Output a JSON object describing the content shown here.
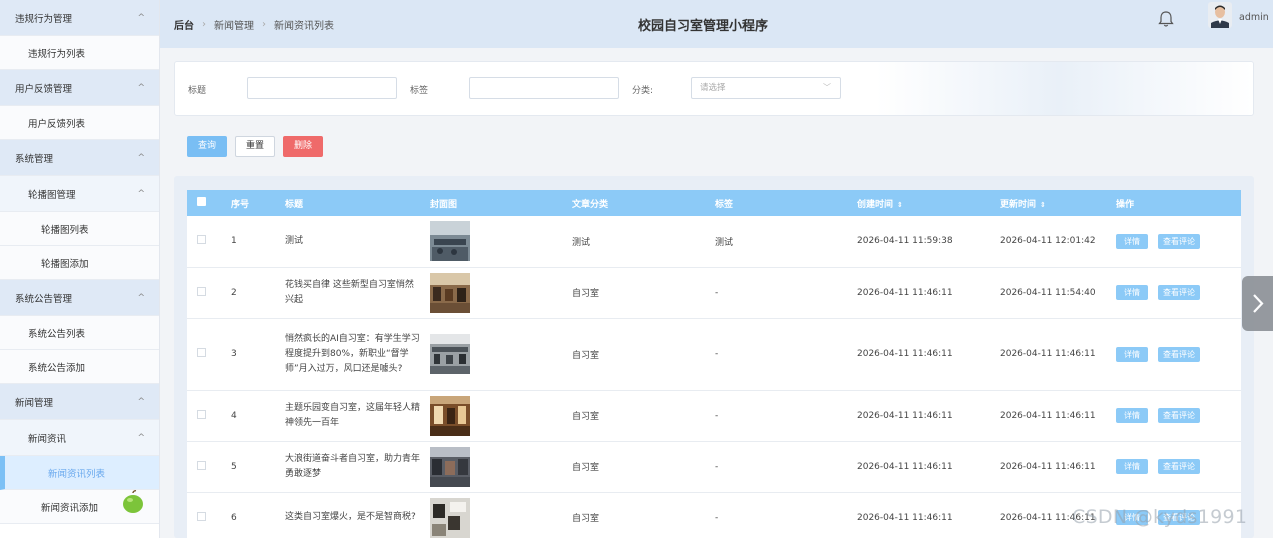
{
  "header": {
    "breadcrumb": [
      "后台",
      "新闻管理",
      "新闻资讯列表"
    ],
    "app_title": "校园自习室管理小程序",
    "user_name": "admin"
  },
  "sidebar": {
    "items": [
      {
        "label": "违规行为管理",
        "kind": "group",
        "caret": "^"
      },
      {
        "label": "违规行为列表",
        "kind": "item"
      },
      {
        "label": "用户反馈管理",
        "kind": "group",
        "caret": "^"
      },
      {
        "label": "用户反馈列表",
        "kind": "item"
      },
      {
        "label": "系统管理",
        "kind": "group",
        "caret": "^"
      },
      {
        "label": "轮播图管理",
        "kind": "sub",
        "caret": "^"
      },
      {
        "label": "轮播图列表",
        "kind": "item3"
      },
      {
        "label": "轮播图添加",
        "kind": "item3"
      },
      {
        "label": "系统公告管理",
        "kind": "group",
        "caret": "^"
      },
      {
        "label": "系统公告列表",
        "kind": "item"
      },
      {
        "label": "系统公告添加",
        "kind": "item"
      },
      {
        "label": "新闻管理",
        "kind": "group",
        "caret": "^"
      },
      {
        "label": "新闻资讯",
        "kind": "sub",
        "caret": "^"
      },
      {
        "label": "新闻资讯列表",
        "kind": "item3",
        "active": true
      },
      {
        "label": "新闻资讯添加",
        "kind": "item3"
      }
    ]
  },
  "search": {
    "title_label": "标题",
    "tag_label": "标签",
    "category_label": "分类:",
    "category_placeholder": "请选择",
    "title_value": "",
    "tag_value": ""
  },
  "actions": {
    "query": "查询",
    "reset": "重置",
    "delete": "删除"
  },
  "table": {
    "columns": [
      "序号",
      "标题",
      "封面图",
      "文章分类",
      "标签",
      "创建时间",
      "更新时间",
      "操作"
    ],
    "sort_icon": "⇕",
    "op_detail": "详情",
    "op_comments": "查看评论",
    "rows": [
      {
        "no": "1",
        "title": "测试",
        "category": "测试",
        "tag": "测试",
        "created": "2026-04-11 11:59:38",
        "updated": "2026-04-11 12:01:42"
      },
      {
        "no": "2",
        "title": "花钱买自律 这些新型自习室悄然兴起",
        "category": "自习室",
        "tag": "-",
        "created": "2026-04-11 11:46:11",
        "updated": "2026-04-11 11:54:40"
      },
      {
        "no": "3",
        "title": "悄然疯长的AI自习室：有学生学习程度提升到80%，新职业“督学师”月入过万，风口还是噱头?",
        "category": "自习室",
        "tag": "-",
        "created": "2026-04-11 11:46:11",
        "updated": "2026-04-11 11:46:11"
      },
      {
        "no": "4",
        "title": "主题乐园变自习室，这届年轻人精神领先一百年",
        "category": "自习室",
        "tag": "-",
        "created": "2026-04-11 11:46:11",
        "updated": "2026-04-11 11:46:11"
      },
      {
        "no": "5",
        "title": "大浪街道奋斗者自习室，助力青年勇敢逐梦",
        "category": "自习室",
        "tag": "-",
        "created": "2026-04-11 11:46:11",
        "updated": "2026-04-11 11:46:11"
      },
      {
        "no": "6",
        "title": "这类自习室爆火，是不是智商税?",
        "category": "自习室",
        "tag": "-",
        "created": "2026-04-11 11:46:11",
        "updated": "2026-04-11 11:46:11"
      }
    ]
  },
  "watermark": "CSDN @kyds1991",
  "colors": {
    "accent": "#8ccaf7",
    "danger": "#ef6a6a",
    "sidebar_group_bg": "#dfe9f6",
    "topbar_bg": "#dbe7f5"
  }
}
